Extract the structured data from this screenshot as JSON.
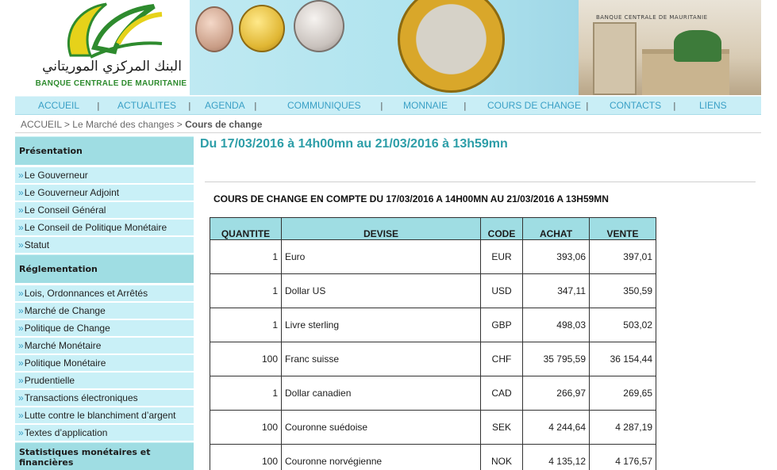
{
  "branding": {
    "name_arabic": "البنك المركزي الموريتاني",
    "name_latin": "BANQUE CENTRALE DE MAURITANIE",
    "building_sign": "BANQUE CENTRALE DE MAURITANIE",
    "colors": {
      "logo_green": "#2e8b2e",
      "logo_yellow": "#e6d21a",
      "accent": "#3aa0c6",
      "header_teal": "#9fdde3"
    }
  },
  "nav": {
    "items": [
      {
        "label": "ACCUEIL"
      },
      {
        "label": "ACTUALITES"
      },
      {
        "label": "AGENDA"
      },
      {
        "label": "COMMUNIQUES"
      },
      {
        "label": "MONNAIE"
      },
      {
        "label": "COURS DE CHANGE"
      },
      {
        "label": "CONTACTS"
      },
      {
        "label": "LIENS"
      }
    ],
    "separator": "|"
  },
  "breadcrumb": {
    "home": "ACCUEIL",
    "sep": ">",
    "parent": "Le Marché des changes",
    "current": "Cours de change"
  },
  "sidebar": {
    "bullet": "»",
    "sections": [
      {
        "heading": "Présentation",
        "items": [
          "Le Gouverneur",
          "Le Gouverneur Adjoint",
          "Le Conseil Général",
          "Le Conseil de Politique Monétaire",
          "Statut"
        ]
      },
      {
        "heading": "Réglementation",
        "items": [
          "Lois, Ordonnances et Arrêtés",
          "Marché de Change",
          "Politique de Change",
          "Marché Monétaire",
          "Politique Monétaire",
          "Prudentielle",
          "Transactions électroniques",
          "Lutte contre le blanchiment d’argent",
          "Textes d’application"
        ]
      },
      {
        "heading": "Statistiques monétaires et financières",
        "items": []
      }
    ]
  },
  "main": {
    "title": "Du 17/03/2016 à 14h00mn au 21/03/2016 à 13h59mn",
    "caption": "COURS DE CHANGE EN COMPTE DU 17/03/2016 A 14H00MN AU 21/03/2016 A 13H59MN",
    "table": {
      "headers": [
        "QUANTITE",
        "DEVISE",
        "CODE",
        "ACHAT",
        "VENTE"
      ],
      "rows": [
        {
          "quantite": "1",
          "devise": "Euro",
          "code": "EUR",
          "achat": "393,06",
          "vente": "397,01"
        },
        {
          "quantite": "1",
          "devise": "Dollar US",
          "code": "USD",
          "achat": "347,11",
          "vente": "350,59"
        },
        {
          "quantite": "1",
          "devise": "Livre sterling",
          "code": "GBP",
          "achat": "498,03",
          "vente": "503,02"
        },
        {
          "quantite": "100",
          "devise": "Franc suisse",
          "code": "CHF",
          "achat": "35 795,59",
          "vente": "36 154,44"
        },
        {
          "quantite": "1",
          "devise": "Dollar canadien",
          "code": "CAD",
          "achat": "266,97",
          "vente": "269,65"
        },
        {
          "quantite": "100",
          "devise": "Couronne suédoise",
          "code": "SEK",
          "achat": "4 244,64",
          "vente": "4 287,19"
        },
        {
          "quantite": "100",
          "devise": "Couronne norvégienne",
          "code": "NOK",
          "achat": "4 135,12",
          "vente": "4 176,57"
        }
      ]
    }
  }
}
